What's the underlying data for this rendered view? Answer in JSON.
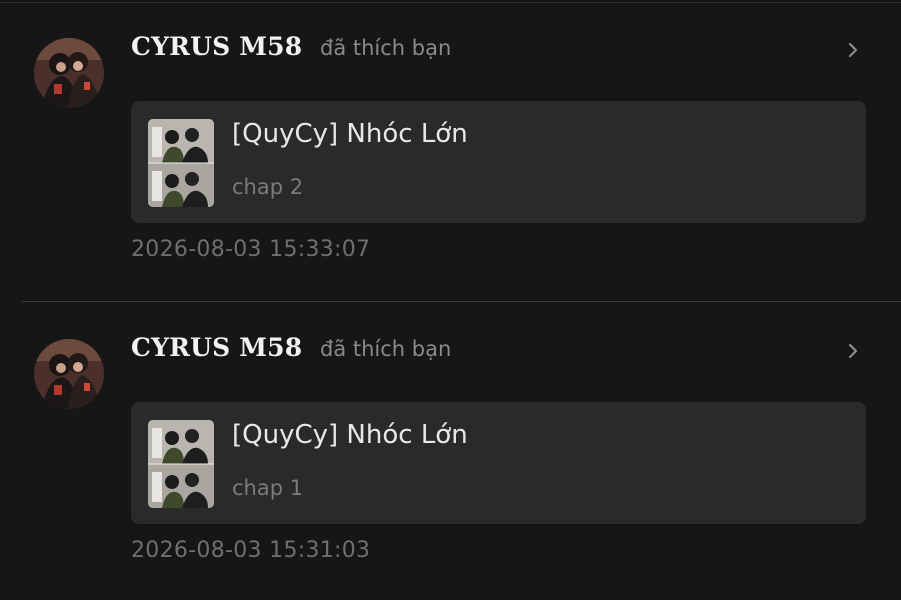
{
  "notifications": [
    {
      "username": "CYRUS M58",
      "action": "đã thích bạn",
      "story_title": "[QuyCy] Nhóc Lớn",
      "chapter": "chap 2",
      "timestamp": "2026-08-03 15:33:07"
    },
    {
      "username": "CYRUS M58",
      "action": "đã thích bạn",
      "story_title": "[QuyCy] Nhóc Lớn",
      "chapter": "chap 1",
      "timestamp": "2026-08-03 15:31:03"
    }
  ],
  "icons": {
    "chevron": "chevron-right-icon",
    "avatar": "user-avatar",
    "thumbnail": "story-cover-thumbnail"
  },
  "colors": {
    "background": "#161616",
    "card": "#2a2a2a",
    "username": "#f2f2f2",
    "secondary_text": "#8a8a8a",
    "timestamp": "#6f6f6f",
    "divider": "#3a3a3a"
  }
}
